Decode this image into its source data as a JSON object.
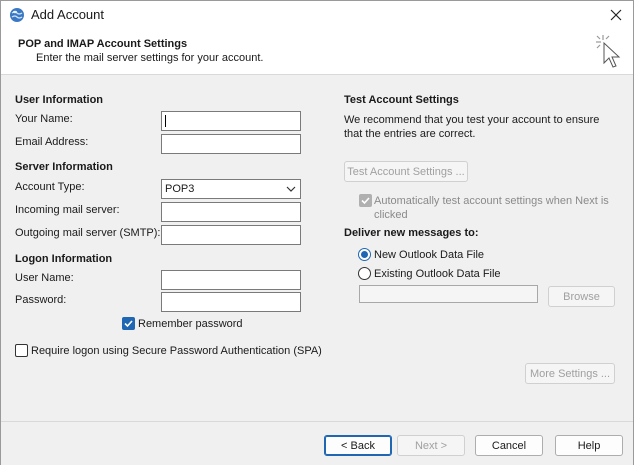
{
  "window": {
    "title": "Add Account"
  },
  "header": {
    "title": "POP and IMAP Account Settings",
    "subtitle": "Enter the mail server settings for your account."
  },
  "user_info": {
    "heading": "User Information",
    "your_name_label": "Your Name:",
    "your_name_value": "",
    "email_label": "Email Address:",
    "email_value": ""
  },
  "server_info": {
    "heading": "Server Information",
    "account_type_label": "Account Type:",
    "account_type_value": "POP3",
    "incoming_label": "Incoming mail server:",
    "incoming_value": "",
    "outgoing_label": "Outgoing mail server (SMTP):",
    "outgoing_value": ""
  },
  "logon_info": {
    "heading": "Logon Information",
    "user_name_label": "User Name:",
    "user_name_value": "",
    "password_label": "Password:",
    "password_value": "",
    "remember_password_label": "Remember password",
    "remember_password_checked": true,
    "spa_label": "Require logon using Secure Password Authentication (SPA)",
    "spa_checked": false
  },
  "test_settings": {
    "heading": "Test Account Settings",
    "description": "We recommend that you test your account to ensure that the entries are correct.",
    "test_button": "Test Account Settings ...",
    "auto_test_label": "Automatically test account settings when Next is clicked",
    "auto_test_checked": true
  },
  "deliver": {
    "heading": "Deliver new messages to:",
    "option_new": "New Outlook Data File",
    "option_existing": "Existing Outlook Data File",
    "selected": "new",
    "existing_path": "",
    "browse_button": "Browse"
  },
  "more_settings_button": "More Settings ...",
  "footer": {
    "back": "< Back",
    "next": "Next >",
    "cancel": "Cancel",
    "help": "Help"
  },
  "colors": {
    "accent": "#1f66b3",
    "background": "#f0f0f0"
  }
}
